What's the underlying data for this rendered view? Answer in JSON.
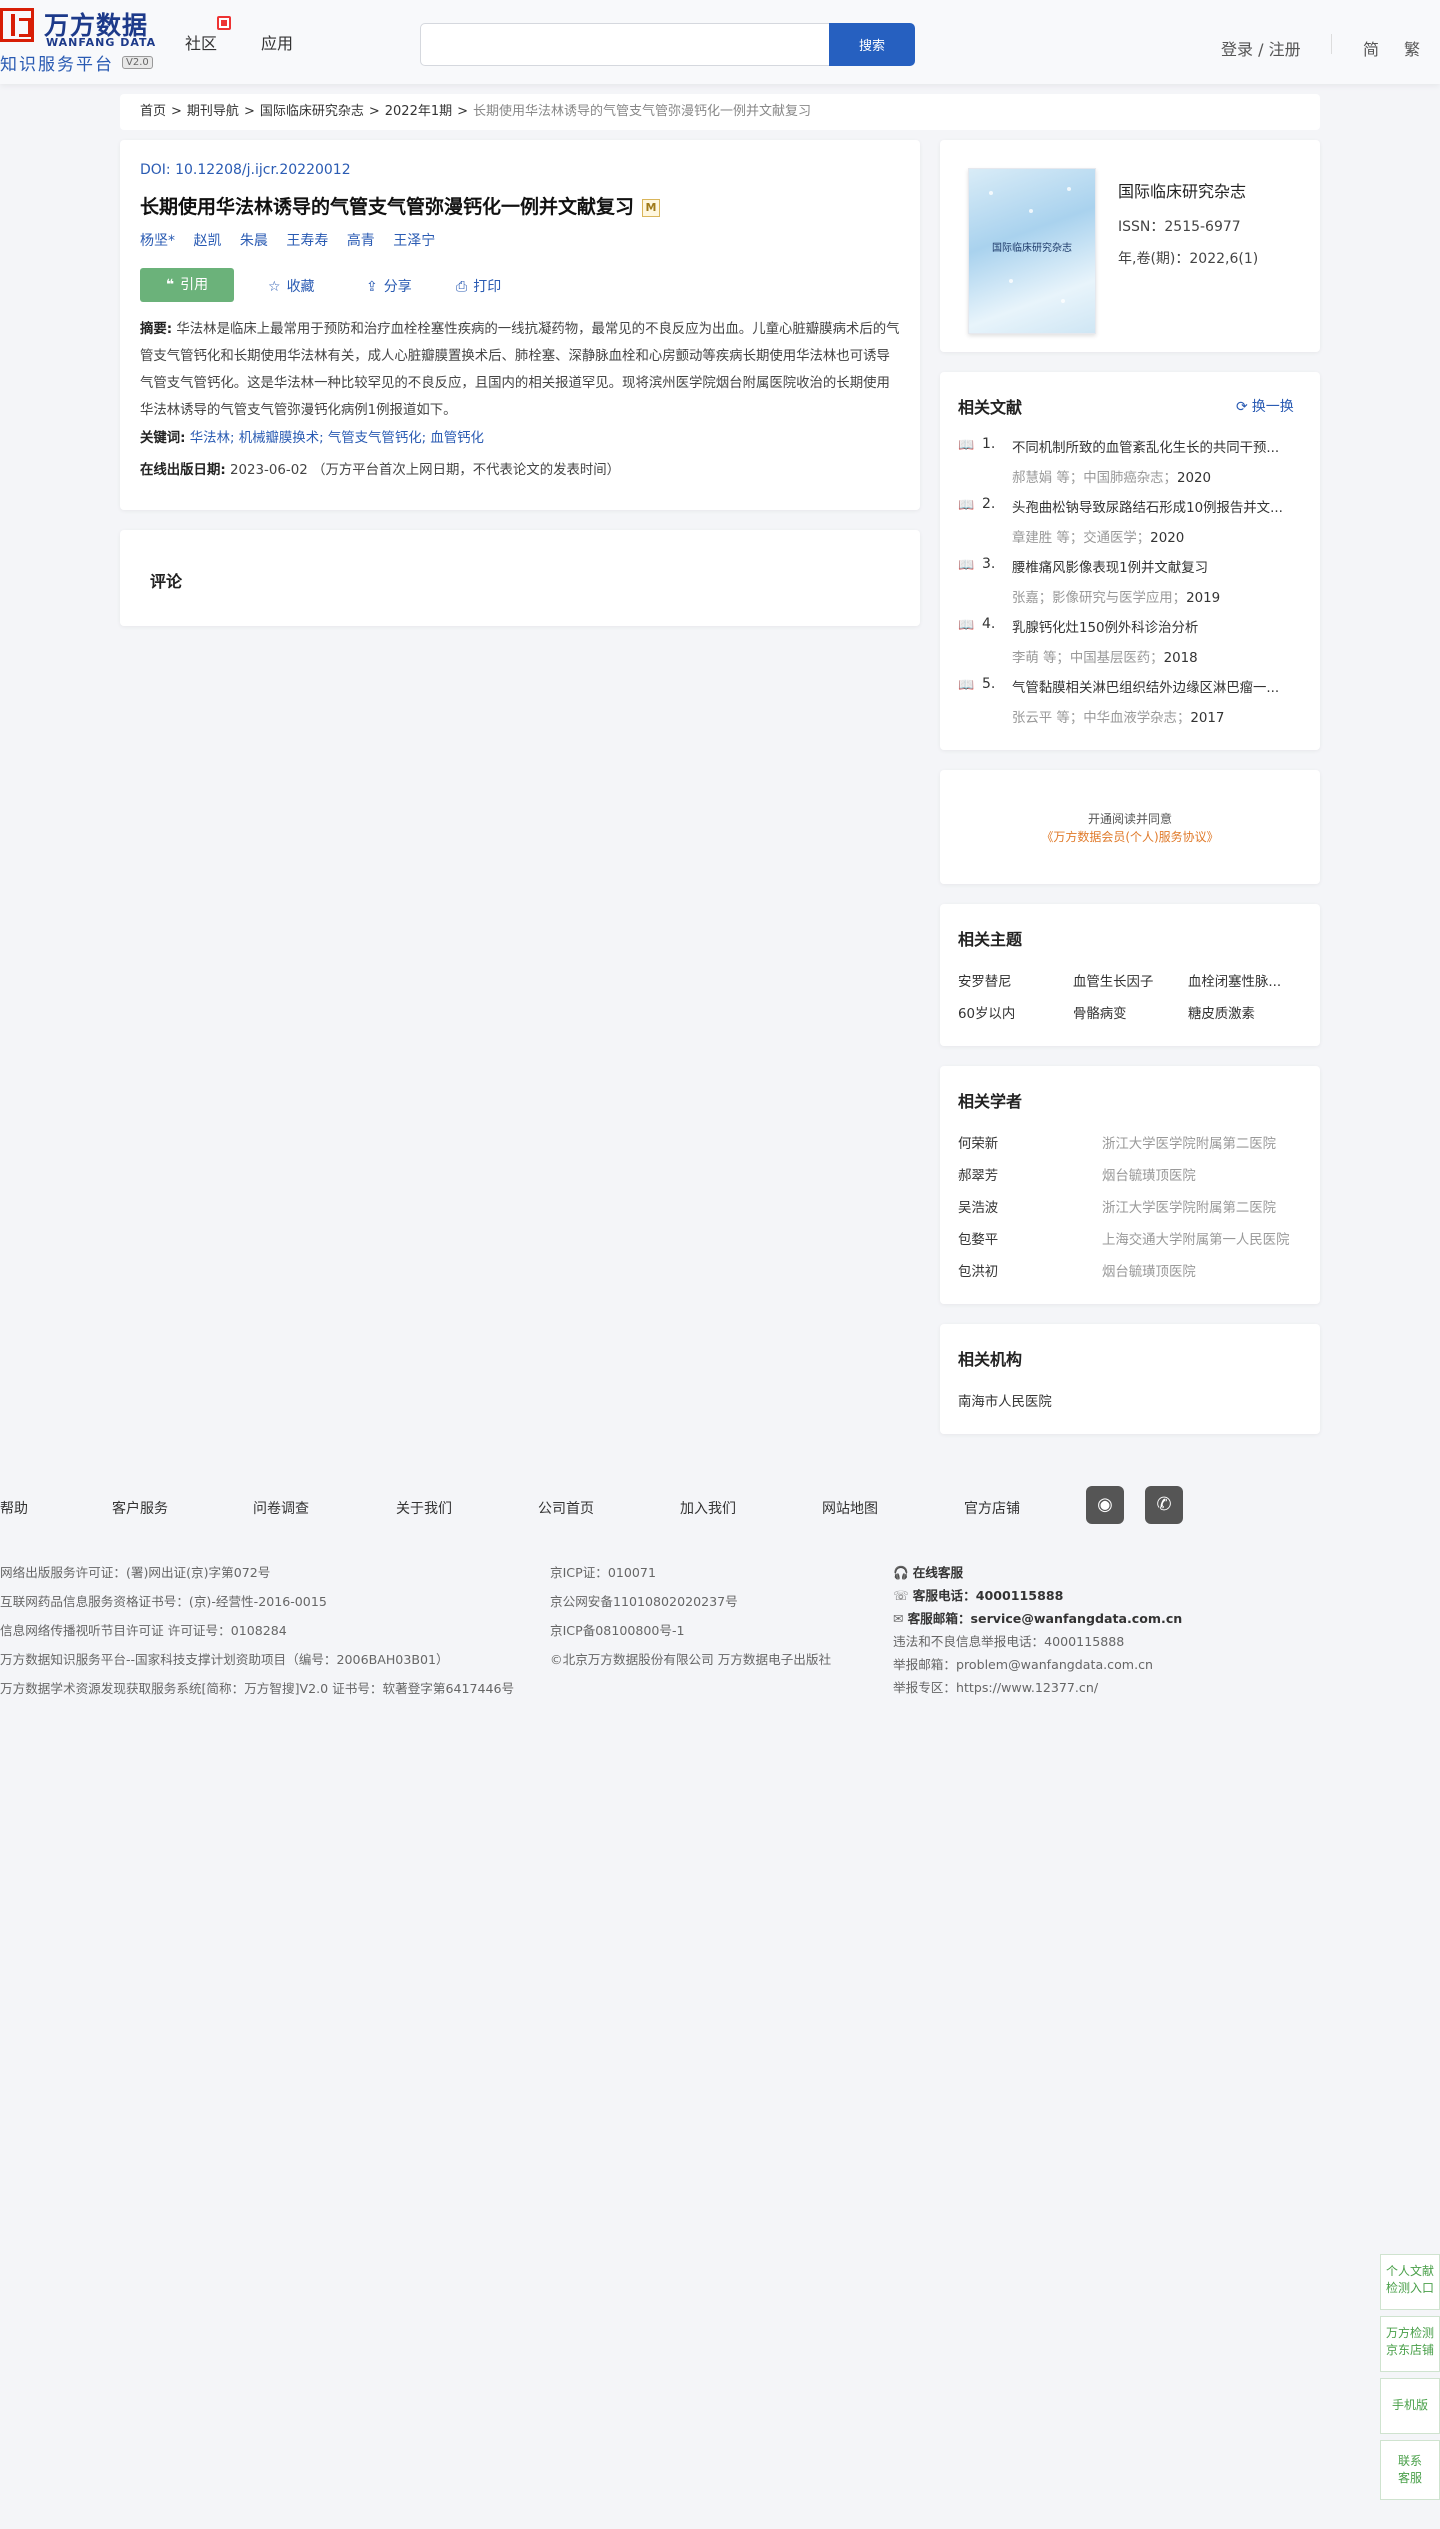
{
  "header": {
    "logo_cn": "万方数据",
    "logo_en": "WANFANG DATA",
    "platform": "知识服务平台",
    "version": "V2.0",
    "nav": [
      "社区",
      "应用"
    ],
    "search_placeholder": "",
    "search_button": "搜索",
    "login": "登录 / 注册",
    "lang_simplified": "简",
    "lang_traditional": "繁"
  },
  "breadcrumb": {
    "items": [
      "首页",
      "期刊导航",
      "国际临床研究杂志",
      "2022年1期"
    ],
    "current": "长期使用华法林诱导的气管支气管弥漫钙化一例并文献复习",
    "separator": ">"
  },
  "article": {
    "doi_label": "DOI:",
    "doi": "10.12208/j.ijcr.20220012",
    "title": "长期使用华法林诱导的气管支气管弥漫钙化一例并文献复习",
    "title_badge": "M",
    "authors": [
      "杨坚*",
      "赵凯",
      "朱晨",
      "王寿寿",
      "高青",
      "王泽宁"
    ],
    "actions": {
      "cite": "引用",
      "favorite": "收藏",
      "share": "分享",
      "print": "打印"
    },
    "abstract_label": "摘要:",
    "abstract": "华法林是临床上最常用于预防和治疗血栓栓塞性疾病的一线抗凝药物，最常见的不良反应为出血。儿童心脏瓣膜病术后的气管支气管钙化和长期使用华法林有关，成人心脏瓣膜置换术后、肺栓塞、深静脉血栓和心房颤动等疾病长期使用华法林也可诱导气管支气管钙化。这是华法林一种比较罕见的不良反应，且国内的相关报道罕见。现将滨州医学院烟台附属医院收治的长期使用华法林诱导的气管支气管弥漫钙化病例1例报道如下。",
    "keywords_label": "关键词:",
    "keywords": [
      "华法林;",
      "机械瓣膜换术;",
      "气管支气管钙化;",
      "血管钙化"
    ],
    "pubdate_label": "在线出版日期:",
    "pubdate": "2023-06-02",
    "pubdate_note": "（万方平台首次上网日期，不代表论文的发表时间）"
  },
  "comment": {
    "title": "评论"
  },
  "journal": {
    "cover_title": "国际临床研究杂志",
    "name": "国际临床研究杂志",
    "issn": "ISSN：2515-6977",
    "year_issue": "年,卷(期)：2022,6(1)"
  },
  "related_literature": {
    "title": "相关文献",
    "refresh": "换一换",
    "items": [
      {
        "num": "1.",
        "title": "不同机制所致的血管紊乱化生长的共同干预...",
        "meta": "郝慧娟  等；中国肺癌杂志；",
        "year": "2020"
      },
      {
        "num": "2.",
        "title": "头孢曲松钠导致尿路结石形成10例报告并文...",
        "meta": "章建胜  等；交通医学；",
        "year": "2020"
      },
      {
        "num": "3.",
        "title": "腰椎痛风影像表现1例并文献复习",
        "meta": "张嘉；影像研究与医学应用；",
        "year": "2019"
      },
      {
        "num": "4.",
        "title": "乳腺钙化灶150例外科诊治分析",
        "meta": "李萌  等；中国基层医药；",
        "year": "2018"
      },
      {
        "num": "5.",
        "title": "气管黏膜相关淋巴组织结外边缘区淋巴瘤一...",
        "meta": "张云平  等；中华血液学杂志；",
        "year": "2017"
      }
    ]
  },
  "agreement": {
    "line1": "开通阅读并同意",
    "line2": "《万方数据会员(个人)服务协议》"
  },
  "topics": {
    "title": "相关主题",
    "items": [
      "安罗替尼",
      "血管生长因子",
      "血栓闭塞性脉...",
      "60岁以内",
      "骨骼病变",
      "糖皮质激素"
    ]
  },
  "scholars": {
    "title": "相关学者",
    "items": [
      {
        "name": "何荣新",
        "org": "浙江大学医学院附属第二医院"
      },
      {
        "name": "郝翠芳",
        "org": "烟台毓璜顶医院"
      },
      {
        "name": "吴浩波",
        "org": "浙江大学医学院附属第二医院"
      },
      {
        "name": "包婺平",
        "org": "上海交通大学附属第一人民医院"
      },
      {
        "name": "包洪初",
        "org": "烟台毓璜顶医院"
      }
    ]
  },
  "institutions": {
    "title": "相关机构",
    "items": [
      "南海市人民医院"
    ]
  },
  "footer": {
    "links": [
      "帮助",
      "客户服务",
      "问卷调查",
      "关于我们",
      "公司首页",
      "加入我们",
      "网站地图",
      "官方店铺"
    ],
    "col1": [
      "网络出版服务许可证：(署)网出证(京)字第072号",
      "互联网药品信息服务资格证书号：(京)-经营性-2016-0015",
      "信息网络传播视听节目许可证 许可证号：0108284",
      "万方数据知识服务平台--国家科技支撑计划资助项目（编号：2006BAH03B01）",
      "万方数据学术资源发现获取服务系统[简称：万方智搜]V2.0 证书号：软著登字第6417446号"
    ],
    "col2": [
      "京ICP证：010071",
      "京公网安备11010802020237号",
      "京ICP备08100800号-1",
      "©北京万方数据股份有限公司 万方数据电子出版社"
    ],
    "contact": {
      "online": "在线客服",
      "phone_label": "客服电话：",
      "phone": "4000115888",
      "email_label": "客服邮箱：",
      "email": "service@wanfangdata.com.cn",
      "report_phone": "违法和不良信息举报电话：4000115888",
      "report_email": "举报邮箱：problem@wanfangdata.com.cn",
      "report_site": "举报专区：https://www.12377.cn/"
    }
  },
  "side_widgets": [
    {
      "line1": "个人文献",
      "line2": "检测入口"
    },
    {
      "line1": "万方检测",
      "line2": "京东店铺"
    },
    {
      "line1": "手机版",
      "line2": ""
    },
    {
      "line1": "联系",
      "line2": "客服"
    }
  ]
}
